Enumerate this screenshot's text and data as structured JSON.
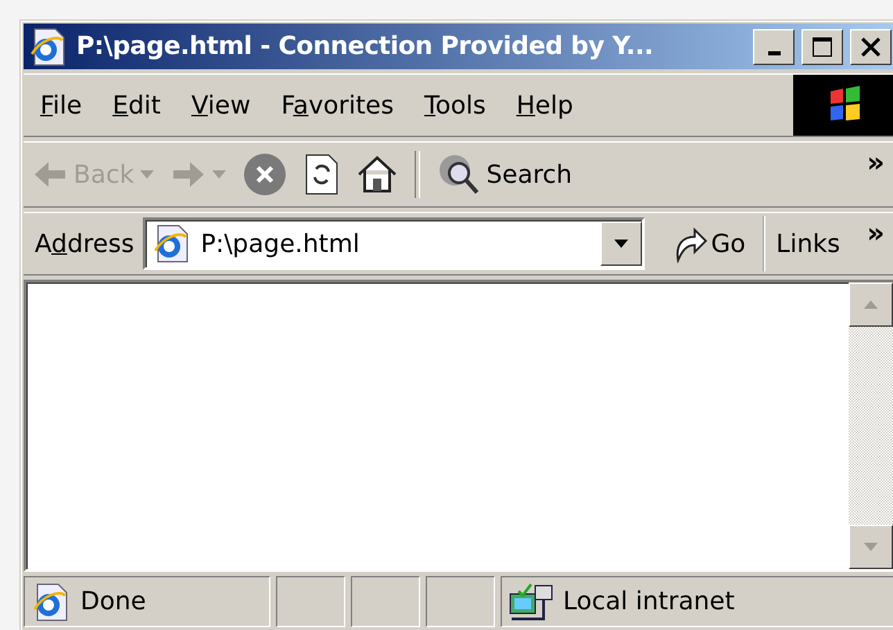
{
  "window": {
    "title": "P:\\page.html - Connection Provided by Y..."
  },
  "menu": [
    {
      "key": "F",
      "post": "ile"
    },
    {
      "key": "E",
      "post": "dit"
    },
    {
      "key": "V",
      "post": "iew"
    },
    {
      "pre": "F",
      "key": "a",
      "post": "vorites"
    },
    {
      "key": "T",
      "post": "ools"
    },
    {
      "key": "H",
      "post": "elp"
    }
  ],
  "toolbar": {
    "buttons": [
      {
        "kind": "back",
        "label": "Back",
        "disabled": true
      },
      {
        "kind": "forward",
        "disabled": true
      },
      {
        "kind": "stop"
      },
      {
        "kind": "refresh"
      },
      {
        "kind": "home"
      },
      {
        "kind": "separator"
      },
      {
        "kind": "search",
        "label": "Search"
      }
    ],
    "overflow": "»"
  },
  "address": {
    "pre": "A",
    "key": "d",
    "post": "dress",
    "value": "P:\\page.html",
    "go": "Go",
    "links": "Links",
    "overflow": "»"
  },
  "status_bar": {
    "text": "Done",
    "zone": "Local intranet"
  }
}
